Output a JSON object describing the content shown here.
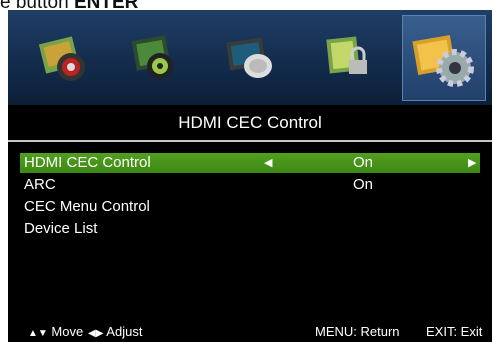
{
  "caption": {
    "prefix": "e button",
    "key": "ENTER"
  },
  "tabs": [
    {
      "icon": "picture-icon"
    },
    {
      "icon": "sound-icon"
    },
    {
      "icon": "channel-icon"
    },
    {
      "icon": "lock-icon"
    },
    {
      "icon": "setup-gear-icon",
      "active": true
    }
  ],
  "menu": {
    "title": "HDMI CEC Control",
    "items": [
      {
        "label": "HDMI CEC Control",
        "value": "On",
        "selected": true
      },
      {
        "label": "ARC",
        "value": "On"
      },
      {
        "label": "CEC Menu Control",
        "value": ""
      },
      {
        "label": "Device List",
        "value": ""
      }
    ]
  },
  "footer": {
    "move": "Move",
    "adjust": "Adjust",
    "menu_return": "MENU: Return",
    "exit": "EXIT: Exit"
  },
  "colors": {
    "selected": "#4a9a1c",
    "iconbar": "#1a365c",
    "panel": "#000000"
  }
}
